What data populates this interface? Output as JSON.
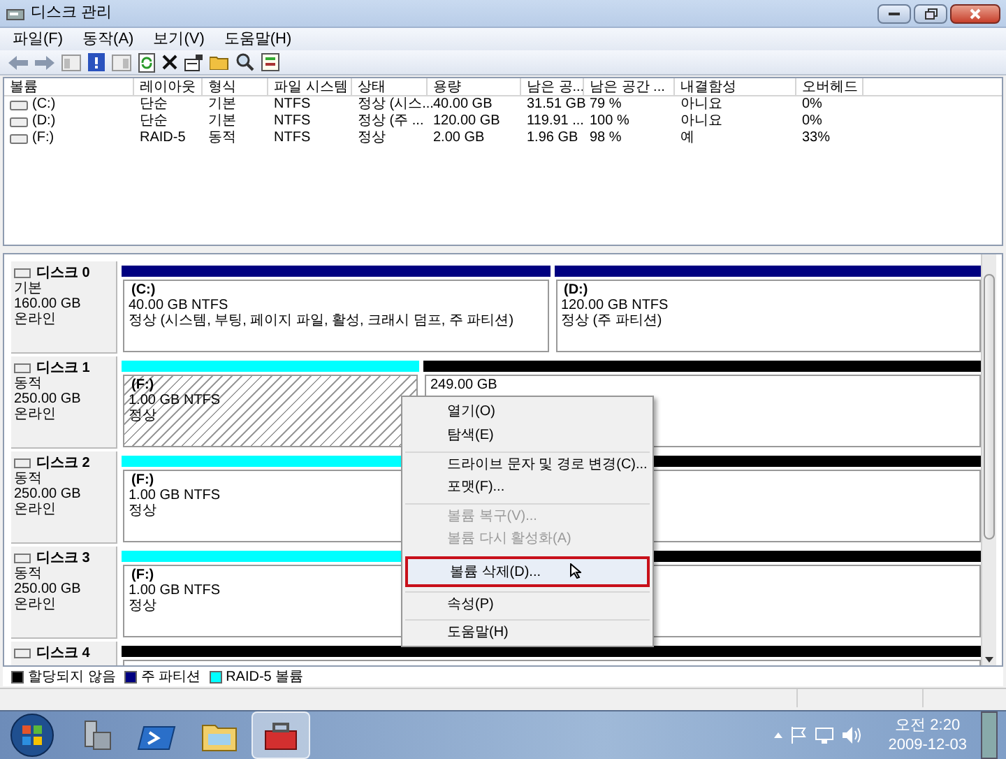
{
  "window": {
    "title": "디스크 관리"
  },
  "menu": [
    "파일(F)",
    "동작(A)",
    "보기(V)",
    "도움말(H)"
  ],
  "volumes": {
    "columns": [
      "볼륨",
      "레이아웃",
      "형식",
      "파일 시스템",
      "상태",
      "용량",
      "남은 공...",
      "남은 공간 ...",
      "내결함성",
      "오버헤드"
    ],
    "rows": [
      {
        "cells": [
          "(C:)",
          "단순",
          "기본",
          "NTFS",
          "정상 (시스...",
          "40.00 GB",
          "31.51 GB",
          "79 %",
          "아니요",
          "0%"
        ]
      },
      {
        "cells": [
          "(D:)",
          "단순",
          "기본",
          "NTFS",
          "정상 (주 ...",
          "120.00 GB",
          "119.91 ...",
          "100 %",
          "아니요",
          "0%"
        ]
      },
      {
        "cells": [
          "(F:)",
          "RAID-5",
          "동적",
          "NTFS",
          "정상",
          "2.00 GB",
          "1.96 GB",
          "98 %",
          "예",
          "33%"
        ]
      }
    ]
  },
  "disks": [
    {
      "name": "디스크 0",
      "type": "기본",
      "size": "160.00 GB",
      "status": "온라인",
      "partitions": [
        {
          "kind": "primary",
          "selected": false,
          "label": "(C:)",
          "detail": "40.00 GB NTFS",
          "status": "정상 (시스템, 부팅, 페이지 파일, 활성, 크래시 덤프, 주 파티션)"
        },
        {
          "kind": "primary",
          "selected": false,
          "label": "(D:)",
          "detail": "120.00 GB NTFS",
          "status": "정상 (주 파티션)"
        }
      ]
    },
    {
      "name": "디스크 1",
      "type": "동적",
      "size": "250.00 GB",
      "status": "온라인",
      "partitions": [
        {
          "kind": "raid5",
          "selected": true,
          "label": "(F:)",
          "detail": "1.00 GB NTFS",
          "status": "정상"
        },
        {
          "kind": "unallocated",
          "selected": false,
          "detail": "249.00 GB"
        }
      ]
    },
    {
      "name": "디스크 2",
      "type": "동적",
      "size": "250.00 GB",
      "status": "온라인",
      "partitions": [
        {
          "kind": "raid5",
          "selected": false,
          "label": "(F:)",
          "detail": "1.00 GB NTFS",
          "status": "정상"
        },
        {
          "kind": "unallocated",
          "selected": false
        }
      ]
    },
    {
      "name": "디스크 3",
      "type": "동적",
      "size": "250.00 GB",
      "status": "온라인",
      "partitions": [
        {
          "kind": "raid5",
          "selected": false,
          "label": "(F:)",
          "detail": "1.00 GB NTFS",
          "status": "정상"
        },
        {
          "kind": "unallocated",
          "selected": false
        }
      ]
    },
    {
      "name": "디스크 4",
      "partitions": [
        {
          "kind": "unallocated",
          "selected": false
        }
      ]
    }
  ],
  "legend": [
    {
      "label": "할당되지 않음",
      "color": "#000000"
    },
    {
      "label": "주 파티션",
      "color": "#000080"
    },
    {
      "label": "RAID-5 볼륨",
      "color": "#00ffff"
    }
  ],
  "context_menu": [
    {
      "label": "열기(O)",
      "disabled": false,
      "selected": false,
      "separator_before": false
    },
    {
      "label": "탐색(E)",
      "disabled": false,
      "selected": false,
      "separator_before": false
    },
    {
      "label": "드라이브 문자 및 경로 변경(C)...",
      "disabled": false,
      "selected": false,
      "separator_before": true
    },
    {
      "label": "포맷(F)...",
      "disabled": false,
      "selected": false,
      "separator_before": false
    },
    {
      "label": "볼륨 복구(V)...",
      "disabled": true,
      "selected": false,
      "separator_before": true
    },
    {
      "label": "볼륨 다시 활성화(A)",
      "disabled": true,
      "selected": false,
      "separator_before": false
    },
    {
      "label": "볼륨 삭제(D)...",
      "disabled": false,
      "selected": true,
      "separator_before": true
    },
    {
      "label": "속성(P)",
      "disabled": false,
      "selected": false,
      "separator_before": true
    },
    {
      "label": "도움말(H)",
      "disabled": false,
      "selected": false,
      "separator_before": true
    }
  ],
  "taskbar": {
    "buttons": [
      {
        "kind": "server",
        "selected": false
      },
      {
        "kind": "shell",
        "selected": false
      },
      {
        "kind": "folder",
        "selected": false
      },
      {
        "kind": "toolbox",
        "selected": true
      }
    ],
    "time": "오전 2:20",
    "date": "2009-12-03"
  }
}
